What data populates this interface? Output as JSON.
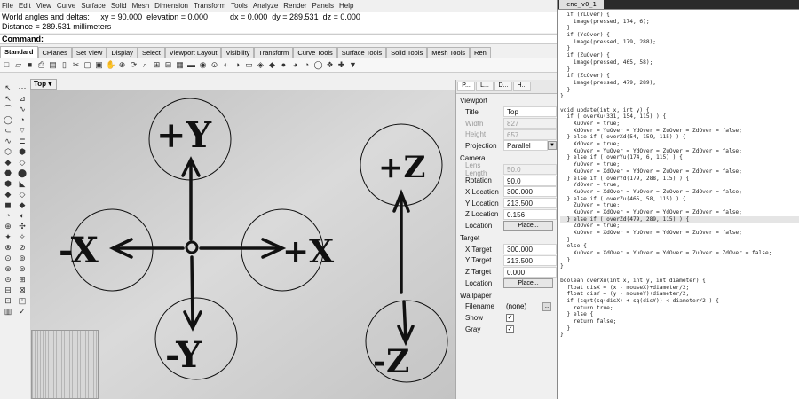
{
  "menu": [
    "File",
    "Edit",
    "View",
    "Curve",
    "Surface",
    "Solid",
    "Mesh",
    "Dimension",
    "Transform",
    "Tools",
    "Analyze",
    "Render",
    "Panels",
    "Help"
  ],
  "history": {
    "line1": "World angles and deltas:     xy = 90.000  elevation = 0.000          dx = 0.000  dy = 289.531  dz = 0.000",
    "line2": "Distance = 289.531 millimeters"
  },
  "command_label": "Command:",
  "tabs": [
    "Standard",
    "CPlanes",
    "Set View",
    "Display",
    "Select",
    "Viewport Layout",
    "Visibility",
    "Transform",
    "Curve Tools",
    "Surface Tools",
    "Solid Tools",
    "Mesh Tools",
    "Ren"
  ],
  "toolbar_icons": [
    "□",
    "▱",
    "■",
    "⎙",
    "▤",
    "▯",
    "✂",
    "▢",
    "▣",
    "✋",
    "⊕",
    "⟳",
    "⌕",
    "⊞",
    "⊟",
    "▦",
    "▬",
    "◉",
    "⊙",
    "◐",
    "◑",
    "▭",
    "◈",
    "◆",
    "●",
    "◕",
    "◔",
    "◯",
    "❖",
    "✚",
    "▼"
  ],
  "sidebar_icons": [
    "↖",
    "⋯",
    "↖",
    "⊿",
    "⌒",
    "∿",
    "◯",
    "◔",
    "⊂",
    "⌔",
    "∿",
    "⊏",
    "⬡",
    "⬢",
    "◆",
    "◇",
    "⬣",
    "⬤",
    "⬢",
    "◣",
    "◆",
    "◇",
    "◼",
    "◆",
    "◔",
    "◐",
    "⊕",
    "✣",
    "✦",
    "✧",
    "⊗",
    "⊘",
    "⊙",
    "⊚",
    "⊛",
    "⊜",
    "⊝",
    "⊞",
    "⊟",
    "⊠",
    "⊡",
    "◰",
    "▥",
    "✓"
  ],
  "viewport": {
    "name": "Top",
    "dropdown": "▾",
    "labels": {
      "plus_y": "+Y",
      "minus_y": "-Y",
      "minus_x": "-X",
      "plus_x": "+X",
      "plus_z": "+Z",
      "minus_z": "-Z"
    }
  },
  "panel": {
    "tabs": [
      "P...",
      "L...",
      "D...",
      "H..."
    ],
    "viewport_section": "Viewport",
    "title": {
      "label": "Title",
      "value": "Top"
    },
    "width": {
      "label": "Width",
      "value": "827"
    },
    "height": {
      "label": "Height",
      "value": "657"
    },
    "projection": {
      "label": "Projection",
      "value": "Parallel"
    },
    "camera_section": "Camera",
    "lens_length": {
      "label": "Lens Length",
      "value": "50.0"
    },
    "rotation": {
      "label": "Rotation",
      "value": "90.0"
    },
    "x_location": {
      "label": "X Location",
      "value": "300.000"
    },
    "y_location": {
      "label": "Y Location",
      "value": "213.500"
    },
    "z_location": {
      "label": "Z Location",
      "value": "0.156"
    },
    "location": {
      "label": "Location",
      "button": "Place..."
    },
    "target_section": "Target",
    "x_target": {
      "label": "X Target",
      "value": "300.000"
    },
    "y_target": {
      "label": "Y Target",
      "value": "213.500"
    },
    "z_target": {
      "label": "Z Target",
      "value": "0.000"
    },
    "target_location": {
      "label": "Location",
      "button": "Place..."
    },
    "wallpaper_section": "Wallpaper",
    "filename": {
      "label": "Filename",
      "value": "(none)",
      "button": "..."
    },
    "show": {
      "label": "Show",
      "checked": "✓"
    },
    "gray": {
      "label": "Gray",
      "checked": "✓"
    }
  },
  "ide": {
    "tab": "cnc_v0_1",
    "lines": [
      "  if (YLOver) {",
      "    image(pressed, 174, 6);",
      "  }",
      "  if (YcOver) {",
      "    image(pressed, 179, 288);",
      "  }",
      "  if (ZuOver) {",
      "    image(pressed, 465, 58);",
      "  }",
      "  if (ZcOver) {",
      "    image(pressed, 479, 289);",
      "  }",
      "}",
      "",
      "void update(int x, int y) {",
      "  if ( overXu(331, 154, 115) ) {",
      "    XuOver = true;",
      "    XdOver = YuOver = YdOver = ZuOver = ZdOver = false;",
      "  } else if ( overXd(54, 159, 115) ) {",
      "    XdOver = true;",
      "    XuOver = YuOver = YdOver = ZuOver = ZdOver = false;",
      "  } else if ( overYu(174, 6, 115) ) {",
      "    YuOver = true;",
      "    XuOver = XdOver = YdOver = ZuOver = ZdOver = false;",
      "  } else if ( overYd(179, 288, 115) ) {",
      "    YdOver = true;",
      "    XuOver = XdOver = YuOver = ZuOver = ZdOver = false;",
      "  } else if ( overZu(465, 58, 115) ) {",
      "    ZuOver = true;",
      "    XuOver = XdOver = YuOver = YdOver = ZdOver = false;",
      "  } else if ( overZd(479, 289, 115) ) {",
      "    ZdOver = true;",
      "    XuOver = XdOver = YuOver = YdOver = ZuOver = false;",
      "  }",
      "  else {",
      "    XuOver = XdOver = YuOver = YdOver = ZuOver = ZdOver = false;",
      "  }",
      "}",
      "",
      "boolean overXu(int x, int y, int diameter) {",
      "  float disX = (x - mouseX)+diameter/2;",
      "  float disY = (y - mouseY)+diameter/2;",
      "  if (sqrt(sq(disX) + sq(disY)) < diameter/2 ) {",
      "    return true;",
      "  } else {",
      "    return false;",
      "  }",
      "}"
    ],
    "highlight_line": 30
  }
}
